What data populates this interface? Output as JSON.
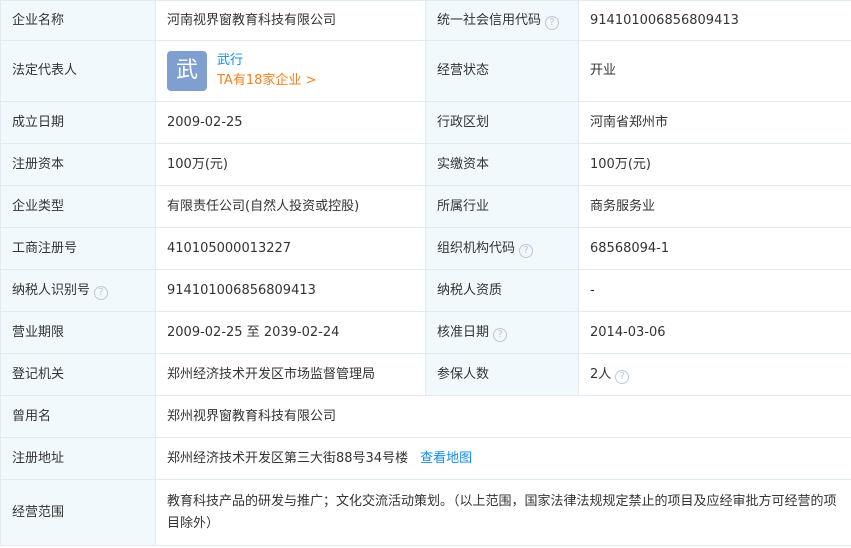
{
  "rows": {
    "company_name": {
      "label": "企业名称",
      "value": "河南视界窗教育科技有限公司"
    },
    "credit_code": {
      "label": "统一社会信用代码",
      "value": "914101006856809413"
    },
    "legal_rep": {
      "label": "法定代表人",
      "avatar_char": "武",
      "name": "武行",
      "link": "TA有18家企业 >"
    },
    "status": {
      "label": "经营状态",
      "value": "开业"
    },
    "founded": {
      "label": "成立日期",
      "value": "2009-02-25"
    },
    "region": {
      "label": "行政区划",
      "value": "河南省郑州市"
    },
    "reg_capital": {
      "label": "注册资本",
      "value": "100万(元)"
    },
    "paid_capital": {
      "label": "实缴资本",
      "value": "100万(元)"
    },
    "company_type": {
      "label": "企业类型",
      "value": "有限责任公司(自然人投资或控股)"
    },
    "industry": {
      "label": "所属行业",
      "value": "商务服务业"
    },
    "reg_number": {
      "label": "工商注册号",
      "value": "410105000013227"
    },
    "org_code": {
      "label": "组织机构代码",
      "value": "68568094-1"
    },
    "taxpayer_id": {
      "label": "纳税人识别号",
      "value": "914101006856809413"
    },
    "taxpayer_qual": {
      "label": "纳税人资质",
      "value": "-"
    },
    "term": {
      "label": "营业期限",
      "value": "2009-02-25 至 2039-02-24"
    },
    "approval_date": {
      "label": "核准日期",
      "value": "2014-03-06"
    },
    "authority": {
      "label": "登记机关",
      "value": "郑州经济技术开发区市场监督管理局"
    },
    "insured": {
      "label": "参保人数",
      "value": "2人"
    },
    "former_name": {
      "label": "曾用名",
      "value": "郑州视界窗教育科技有限公司"
    },
    "address": {
      "label": "注册地址",
      "value": "郑州经济技术开发区第三大街88号34号楼",
      "link": "查看地图"
    },
    "scope": {
      "label": "经营范围",
      "value": "教育科技产品的研发与推广；文化交流活动策划。（以上范围，国家法律法规规定禁止的项目及应经审批方可经营的项目除外）"
    }
  },
  "help_glyph": "?",
  "colors": {
    "label_bg": "#f2f9fc",
    "border": "#e4eaf2",
    "link_blue": "#128bed",
    "link_orange": "#f5811f",
    "avatar_bg": "#7e9fcf"
  }
}
